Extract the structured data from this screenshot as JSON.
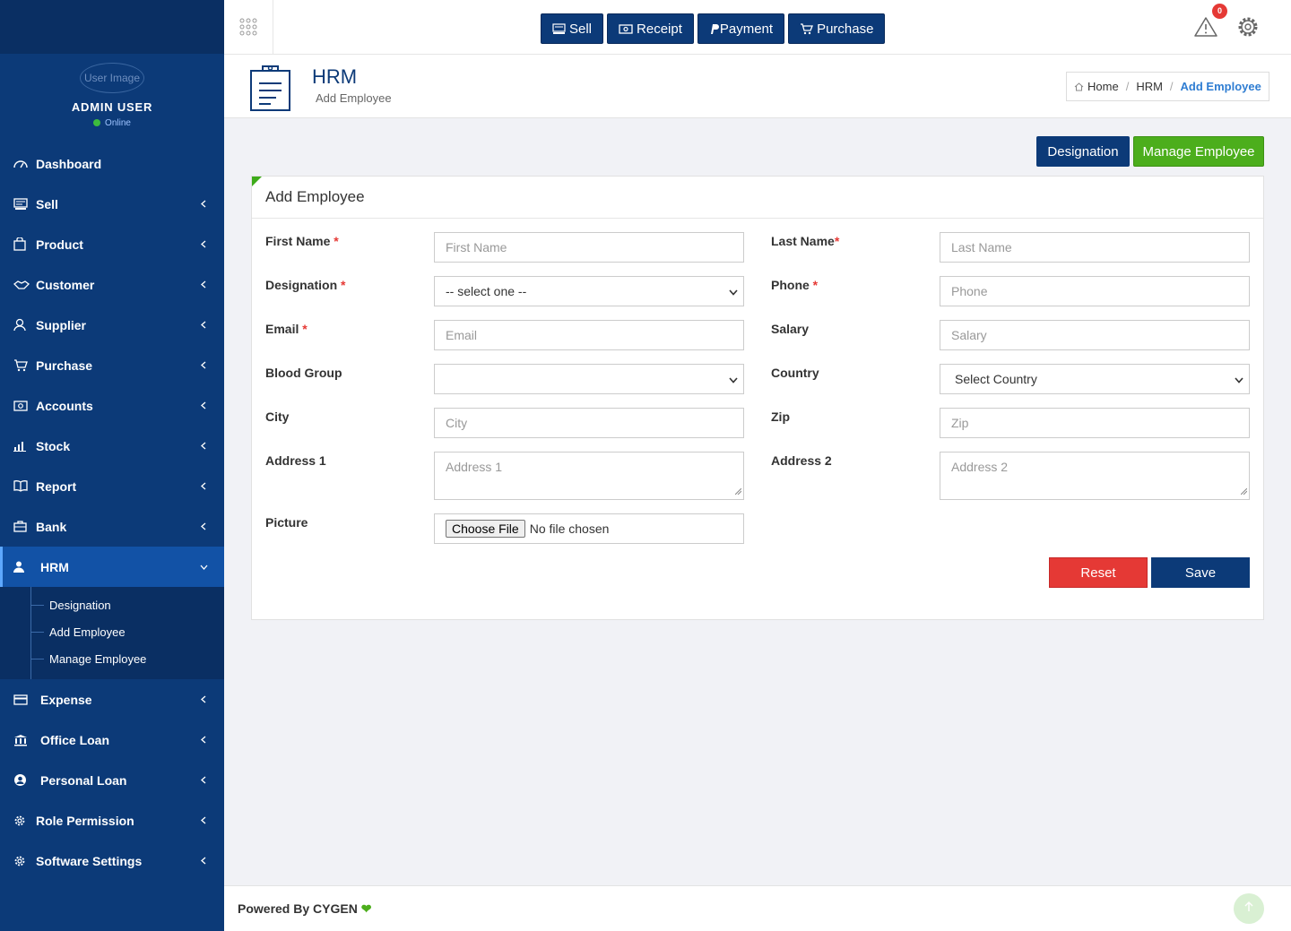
{
  "sidebar": {
    "user": {
      "avatar_alt": "User Image",
      "name": "ADMIN USER",
      "status": "Online"
    },
    "menu": [
      {
        "label": "Dashboard",
        "icon": "dashboard-icon"
      },
      {
        "label": "Sell",
        "icon": "sell-icon"
      },
      {
        "label": "Product",
        "icon": "product-icon"
      },
      {
        "label": "Customer",
        "icon": "handshake-icon"
      },
      {
        "label": "Supplier",
        "icon": "user-icon"
      },
      {
        "label": "Purchase",
        "icon": "cart-icon"
      },
      {
        "label": "Accounts",
        "icon": "money-icon"
      },
      {
        "label": "Stock",
        "icon": "bar-chart-icon"
      },
      {
        "label": "Report",
        "icon": "book-icon"
      },
      {
        "label": "Bank",
        "icon": "briefcase-icon"
      },
      {
        "label": "HRM",
        "icon": "person-icon"
      },
      {
        "label": "Expense",
        "icon": "credit-card-icon"
      },
      {
        "label": "Office Loan",
        "icon": "bank-icon"
      },
      {
        "label": "Personal Loan",
        "icon": "user-circle-icon"
      },
      {
        "label": "Role Permission",
        "icon": "gear-icon"
      },
      {
        "label": "Software Settings",
        "icon": "gear-icon"
      }
    ],
    "hrm_submenu": [
      "Designation",
      "Add Employee",
      "Manage Employee"
    ]
  },
  "topbar": {
    "quick_buttons": [
      {
        "label": "Sell",
        "icon": "register-icon"
      },
      {
        "label": "Receipt",
        "icon": "money-icon"
      },
      {
        "label": "Payment",
        "icon": "paypal-icon"
      },
      {
        "label": "Purchase",
        "icon": "cart-icon"
      }
    ],
    "alert_count": "0"
  },
  "header": {
    "title": "HRM",
    "subtitle": "Add Employee",
    "breadcrumb": [
      "Home",
      "HRM",
      "Add Employee"
    ]
  },
  "actions": {
    "designation": "Designation",
    "manage_employee": "Manage Employee"
  },
  "form": {
    "title": "Add Employee",
    "first_name": {
      "label": "First Name",
      "placeholder": "First Name"
    },
    "last_name": {
      "label": "Last Name",
      "placeholder": "Last Name"
    },
    "designation": {
      "label": "Designation",
      "value": "-- select one --"
    },
    "phone": {
      "label": "Phone",
      "placeholder": "Phone"
    },
    "email": {
      "label": "Email",
      "placeholder": "Email"
    },
    "salary": {
      "label": "Salary",
      "placeholder": "Salary"
    },
    "blood_group": {
      "label": "Blood Group",
      "value": ""
    },
    "country": {
      "label": "Country",
      "value": "Select Country"
    },
    "city": {
      "label": "City",
      "placeholder": "City"
    },
    "zip": {
      "label": "Zip",
      "placeholder": "Zip"
    },
    "address1": {
      "label": "Address 1",
      "placeholder": "Address 1"
    },
    "address2": {
      "label": "Address 2",
      "placeholder": "Address 2"
    },
    "picture": {
      "label": "Picture",
      "button": "Choose File",
      "status": "No file chosen"
    },
    "reset": "Reset",
    "save": "Save",
    "required_mark": "*"
  },
  "footer": {
    "text": "Powered By CYGEN"
  },
  "colors": {
    "primary": "#0c3a78",
    "success": "#4cae1c",
    "danger": "#e53935",
    "link": "#2f7dd2"
  }
}
